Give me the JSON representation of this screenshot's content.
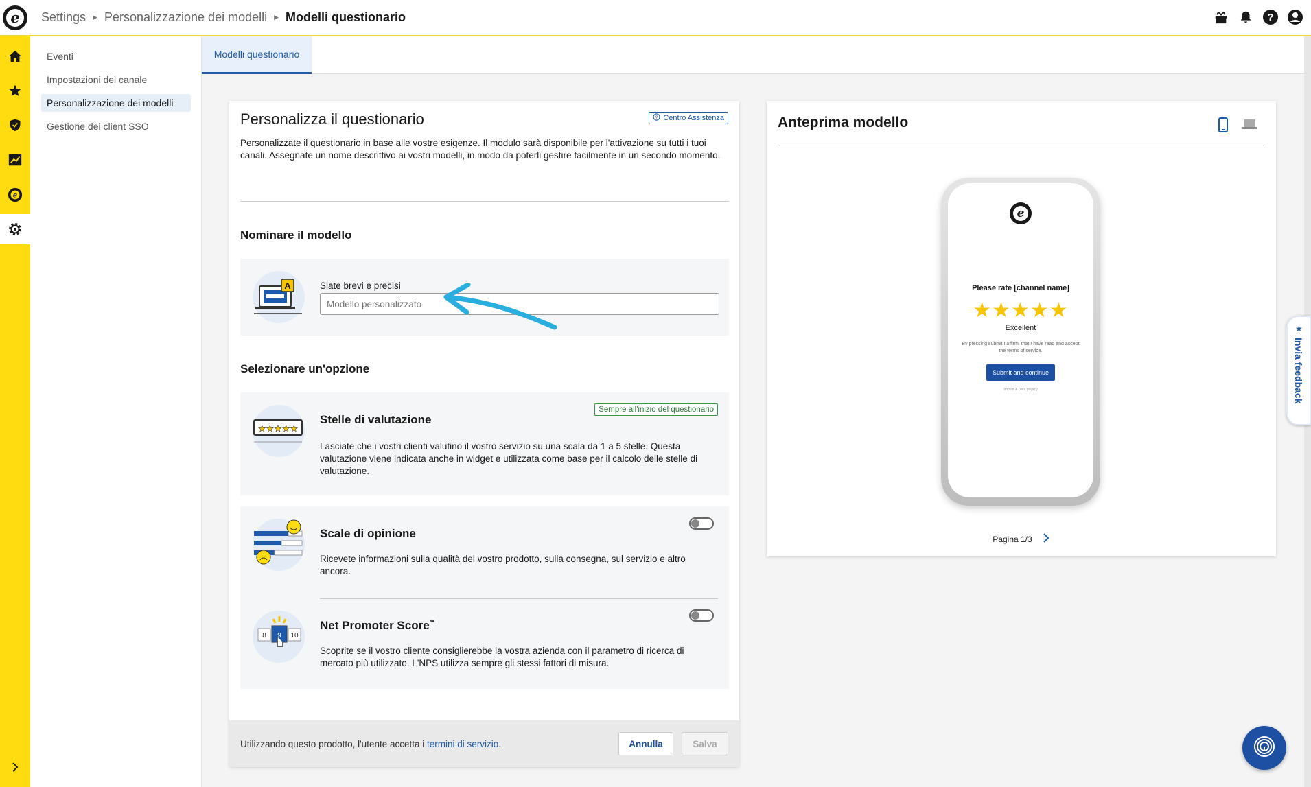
{
  "breadcrumb": {
    "settings": "Settings",
    "customization": "Personalizzazione dei modelli",
    "current": "Modelli questionario"
  },
  "icons": {
    "top": [
      "gift-icon",
      "bell-icon",
      "help-icon",
      "account-icon"
    ],
    "rail": [
      "home-icon",
      "star-icon",
      "shield-icon",
      "chart-icon",
      "trustedshops-icon",
      "gear-icon"
    ]
  },
  "sidenav": {
    "items": [
      {
        "label": "Eventi"
      },
      {
        "label": "Impostazioni del canale"
      },
      {
        "label": "Personalizzazione dei modelli"
      },
      {
        "label": "Gestione dei client SSO"
      }
    ]
  },
  "tab": {
    "label": "Modelli questionario"
  },
  "left": {
    "title": "Personalizza il questionario",
    "help_label": "Centro Assistenza",
    "intro": "Personalizzate il questionario in base alle vostre esigenze. Il modulo sarà disponibile per l'attivazione su tutti i tuoi canali. Assegnate un nome descrittivo ai vostri modelli, in modo da poterli gestire facilmente in un secondo momento.",
    "name_section": "Nominare il modello",
    "field_label": "Siate brevi e precisi",
    "field_placeholder": "Modello personalizzato",
    "option_section": "Selezionare un'opzione",
    "options": [
      {
        "title": "Stelle di valutazione",
        "badge": "Sempre all'inizio del questionario",
        "desc": "Lasciate che i vostri clienti valutino il vostro servizio su una scala da 1 a 5 stelle. Questa valutazione viene indicata anche in widget e utilizzata come base per il calcolo delle stelle di valutazione."
      },
      {
        "title": "Scale di opinione",
        "desc": "Ricevete informazioni sulla qualità del vostro prodotto, sulla consegna, sul servizio e altro ancora.",
        "enabled": false
      },
      {
        "title": "Net Promoter Score",
        "sup": "℠",
        "desc": "Scoprite se il vostro cliente consiglierebbe la vostra azienda con il parametro di ricerca di mercato più utilizzato. L'NPS utilizza sempre gli stessi fattori di misura.",
        "enabled": false,
        "nps_numbers": [
          "8",
          "9",
          "10"
        ]
      }
    ],
    "footer_text": "Utilizzando questo prodotto, l'utente accetta i ",
    "footer_link": "termini di servizio",
    "footer_end": ".",
    "cancel": "Annulla",
    "save": "Salva"
  },
  "preview": {
    "title": "Anteprima modello",
    "rate_title": "Please rate [channel name]",
    "stars": "★★★★★",
    "star_label": "Excellent",
    "legal_text": "By pressing submit I affirm, that I have read and accept the ",
    "legal_link": "terms of service",
    "legal_end": ".",
    "submit": "Submit and continue",
    "imprint": "Imprint & Data privacy",
    "pager": "Pagina 1/3"
  },
  "feedback": {
    "label": "Invia feedback"
  },
  "colors": {
    "accent": "#1d5baa",
    "rail": "#ffdc0f",
    "star": "#f7c500"
  }
}
